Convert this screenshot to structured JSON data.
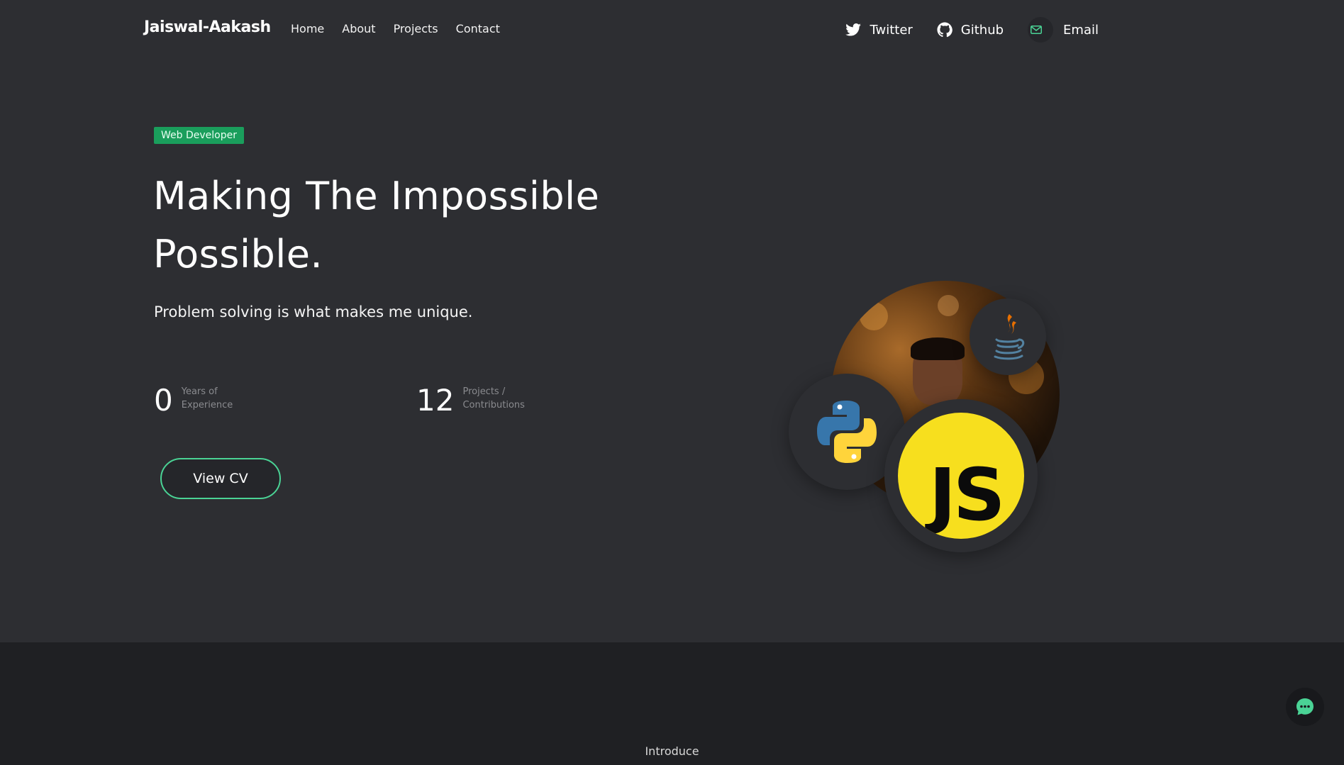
{
  "nav": {
    "logo": "Jaiswal-Aakash",
    "links": [
      "Home",
      "About",
      "Projects",
      "Contact"
    ],
    "socials": [
      {
        "label": "Twitter",
        "icon": "twitter-icon"
      },
      {
        "label": "Github",
        "icon": "github-icon"
      },
      {
        "label": "Email",
        "icon": "mail-icon"
      }
    ]
  },
  "hero": {
    "badge": "Web Developer",
    "headline_line1": "Making The Impossible",
    "headline_line2": "Possible.",
    "tagline": "Problem solving is what makes me unique.",
    "stats": [
      {
        "value": "0",
        "label_line1": "Years of",
        "label_line2": "Experience"
      },
      {
        "value": "12",
        "label_line1": "Projects /",
        "label_line2": "Contributions"
      }
    ],
    "cv_button": "View CV",
    "skill_icons": [
      "java-icon",
      "python-icon",
      "javascript-icon"
    ],
    "js_logo_text": "JS"
  },
  "section": {
    "introduce": "Introduce"
  },
  "colors": {
    "background": "#2d2e32",
    "accent": "#4ad395",
    "badge": "#1a9e5c",
    "lower_background": "#1f2023",
    "js_yellow": "#f7df1e"
  }
}
